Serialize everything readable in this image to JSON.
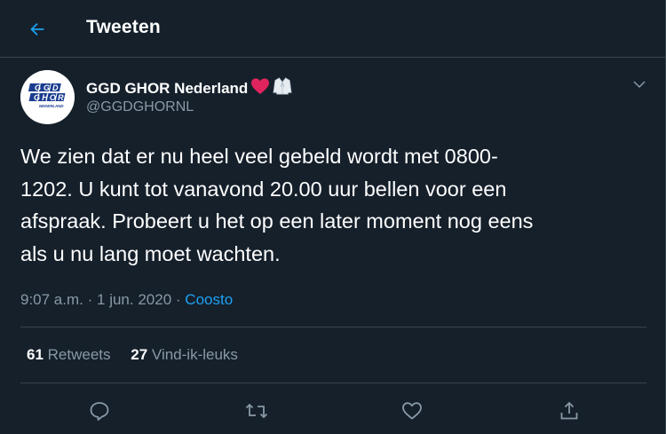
{
  "header": {
    "title": "Tweeten",
    "back_icon": "arrow-left-icon",
    "accent_color": "#1da1f2"
  },
  "tweet": {
    "author": {
      "name": "GGD GHOR Nederland",
      "emojis": [
        "red-heart-emoji",
        "lab-coat-emoji"
      ],
      "handle": "@GGDGHORNL",
      "avatar_text_top": "GGD",
      "avatar_text_mid": "GHOR",
      "avatar_text_bottom": "NEDERLAND"
    },
    "text_lines": [
      "We zien dat er nu heel veel gebeld wordt met 0800-",
      "1202. U kunt tot vanavond 20.00 uur bellen voor een",
      "afspraak. Probeert u het op een later moment nog eens",
      "als u nu lang moet wachten."
    ],
    "time": "9:07 a.m.",
    "separator": "·",
    "date": "1 jun. 2020",
    "source": "Coosto",
    "retweets_count": "61",
    "retweets_label": "Retweets",
    "likes_count": "27",
    "likes_label": "Vind-ik-leuks"
  },
  "actions": [
    "reply-icon",
    "retweet-icon",
    "like-icon",
    "share-icon"
  ],
  "colors": {
    "background": "#15202b",
    "border": "#38444d",
    "secondary_text": "#8899a6",
    "link": "#1da1f2"
  }
}
